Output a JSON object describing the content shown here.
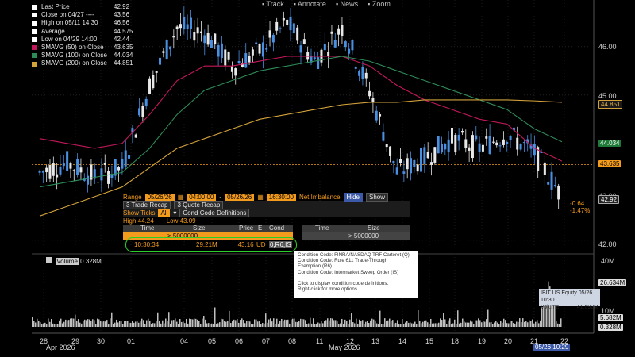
{
  "toolbar": {
    "track": "Track",
    "annotate": "Annotate",
    "news": "News",
    "zoom": "Zoom"
  },
  "legend": [
    {
      "label": "Last Price",
      "value": "42.92",
      "color": "#ffffff"
    },
    {
      "label": "Close on 04/27 ----",
      "value": "43.56",
      "color": "#ffffff"
    },
    {
      "label": "High on 05/11 14:30",
      "value": "46.56",
      "color": "#ffffff"
    },
    {
      "label": "Average",
      "value": "44.575",
      "color": "#ffffff"
    },
    {
      "label": "Low on 04/29 14:00",
      "value": "42.44",
      "color": "#ffffff"
    },
    {
      "label": "SMAVG (50) on Close",
      "value": "43.635",
      "color": "#c2185b"
    },
    {
      "label": "SMAVG (100) on Close",
      "value": "44.034",
      "color": "#2e8b57"
    },
    {
      "label": "SMAVG (200) on Close",
      "value": "44.851",
      "color": "#d4a23a"
    }
  ],
  "axis": {
    "y_ticks": [
      "46.00",
      "45.00",
      "42.00"
    ],
    "y_tick_mid": "43.00",
    "badges": {
      "sma200": "44.851",
      "sma100": "44.034",
      "sma50": "43.635",
      "last": "42.92",
      "chg": "-0.64",
      "chgpct": "-1.47%"
    }
  },
  "panel": {
    "range_label": "Range",
    "date1": "05/26/26",
    "time1": "04:00:00",
    "date2": "05/26/26",
    "time2": "16:30:00",
    "net_imbalance": "Net Imbalance",
    "hide": "Hide",
    "show": "Show",
    "tab1": "3 Trade Recap",
    "tab2": "3 Quote Recap",
    "show_ticks": "Show Ticks",
    "all": "All",
    "cond_defs": "Cond Code Definitions",
    "high": "High  44.24",
    "low": "Low  43.09"
  },
  "table": {
    "headers": [
      "Time",
      "Size",
      "Price",
      "E",
      "Cond",
      "Time",
      "Size"
    ],
    "filter": "> 5000000",
    "filter2": "> 5000000",
    "row": {
      "time": "10:30:34",
      "size": "29.21M",
      "price": " 43.16",
      "e": "UD",
      "cond": "0,R6,IS"
    }
  },
  "tooltip": [
    "Condition Code: FINRA/NASDAQ TRF Carteret (Q)",
    "Condition Code: Rule 611 Trade-Through",
    "Exemption (R6)",
    "Condition Code: Intermarket Sweep Order (IS)",
    "",
    "Click to display condition code definitions.",
    "Right-click for more options."
  ],
  "volume": {
    "label": "Volume",
    "value": "0.328M",
    "axis": [
      "40M",
      "10M"
    ],
    "badges": {
      "v1": "26.634M",
      "v2": "5.682M",
      "v3": "0.328M"
    },
    "tip1": "IBIT US Equity 05/26 10:30",
    "tip2": "Volume",
    "tip2v": "41.592M"
  },
  "xaxis": {
    "days": [
      "28",
      "29",
      "30",
      "01",
      "04",
      "05",
      "06",
      "07",
      "08",
      "11",
      "12",
      "13",
      "14",
      "15",
      "18",
      "19",
      "20",
      "21",
      "22",
      "26"
    ],
    "month1": "Apr 2026",
    "month2": "May 2026",
    "stamp": "05/26 10:29"
  },
  "chart_data": {
    "type": "line",
    "series": [
      {
        "name": "Last Price",
        "values": [
          43.4,
          43.6,
          43.3,
          43.5,
          45.2,
          46.4,
          46.3,
          45.6,
          45.9,
          46.5,
          45.7,
          46.4,
          45.1,
          43.4,
          43.7,
          44.1,
          43.9,
          44.2,
          43.8,
          42.9
        ]
      },
      {
        "name": "SMAVG (50) on Close",
        "values": [
          44.1,
          44.0,
          43.9,
          44.0,
          44.6,
          45.3,
          45.6,
          45.6,
          45.7,
          45.8,
          45.8,
          45.8,
          45.6,
          45.2,
          44.9,
          44.7,
          44.5,
          44.4,
          43.9,
          43.635
        ]
      },
      {
        "name": "SMAVG (100) on Close",
        "values": [
          43.1,
          43.2,
          43.3,
          43.4,
          43.9,
          44.6,
          45.1,
          45.3,
          45.5,
          45.6,
          45.7,
          45.8,
          45.7,
          45.5,
          45.3,
          45.1,
          44.9,
          44.7,
          44.3,
          44.034
        ]
      },
      {
        "name": "SMAVG (200) on Close",
        "values": [
          42.5,
          42.7,
          42.9,
          43.1,
          43.5,
          43.9,
          44.1,
          44.3,
          44.5,
          44.6,
          44.7,
          44.8,
          44.85,
          44.85,
          44.9,
          44.9,
          44.9,
          44.9,
          44.88,
          44.851
        ]
      }
    ],
    "ylim": [
      41.8,
      46.8
    ]
  }
}
